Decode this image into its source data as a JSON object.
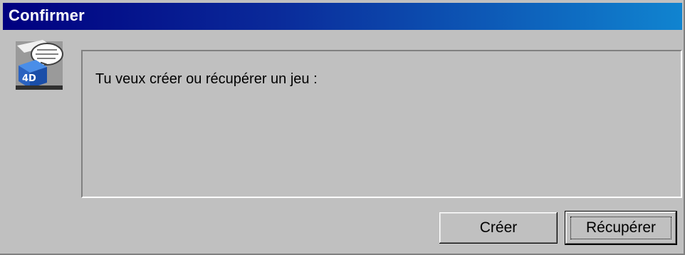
{
  "window": {
    "title": "Confirmer"
  },
  "message": {
    "text": "Tu veux créer ou récupérer un jeu :"
  },
  "icon": {
    "name": "4d-database-dialog-icon"
  },
  "buttons": {
    "create_label": "Créer",
    "recover_label": "Récupérer",
    "default": "recover"
  },
  "colors": {
    "titlebar_start": "#000080",
    "titlebar_end": "#1084d0",
    "face": "#c0c0c0"
  }
}
